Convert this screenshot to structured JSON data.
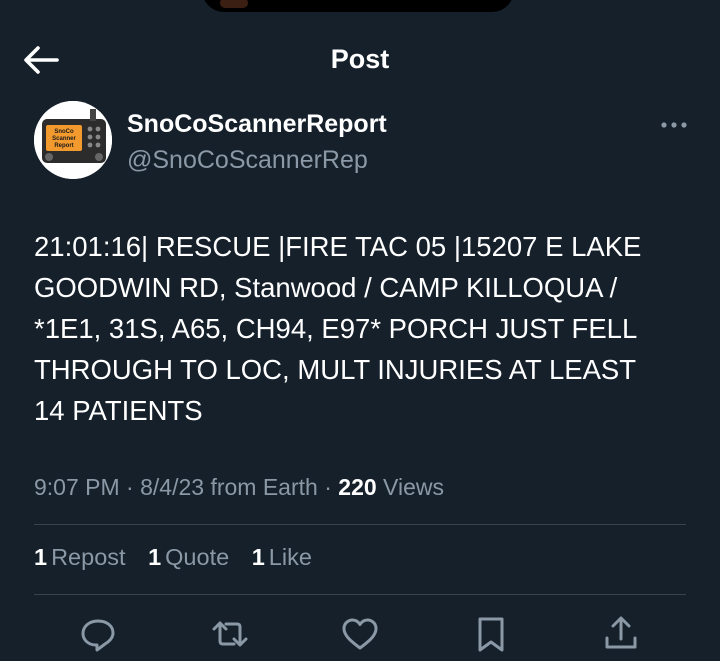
{
  "header": {
    "title": "Post",
    "back_icon": "arrow-left-icon"
  },
  "author": {
    "display_name": "SnoCoScannerReport",
    "handle": "@SnoCoScannerRep",
    "avatar_text": [
      "SnoCo",
      "Scanner",
      "Report"
    ],
    "more_icon": "more-horizontal-icon"
  },
  "tweet": {
    "text_lines": [
      "21:01:16| RESCUE |FIRE TAC 05 |15207 E LAKE",
      "GOODWIN RD, Stanwood / CAMP KILLOQUA /",
      "*1E1, 31S, A65, CH94, E97* PORCH JUST FELL",
      "THROUGH TO LOC, MULT INJURIES AT LEAST",
      "14 PATIENTS"
    ]
  },
  "meta": {
    "time": "9:07 PM",
    "date": "8/4/23",
    "source": "from Earth",
    "views_count": "220",
    "views_label": "Views",
    "separator": "·"
  },
  "stats": {
    "reposts": {
      "count": "1",
      "label": "Repost"
    },
    "quotes": {
      "count": "1",
      "label": "Quote"
    },
    "likes": {
      "count": "1",
      "label": "Like"
    }
  },
  "actions": [
    "reply-icon",
    "repost-icon",
    "like-icon",
    "bookmark-icon",
    "share-icon"
  ],
  "colors": {
    "background": "#15202b",
    "primary_text": "#ffffff",
    "secondary_text": "#8b98a5",
    "divider": "#38444d",
    "avatar_screen": "#f29a2e"
  }
}
